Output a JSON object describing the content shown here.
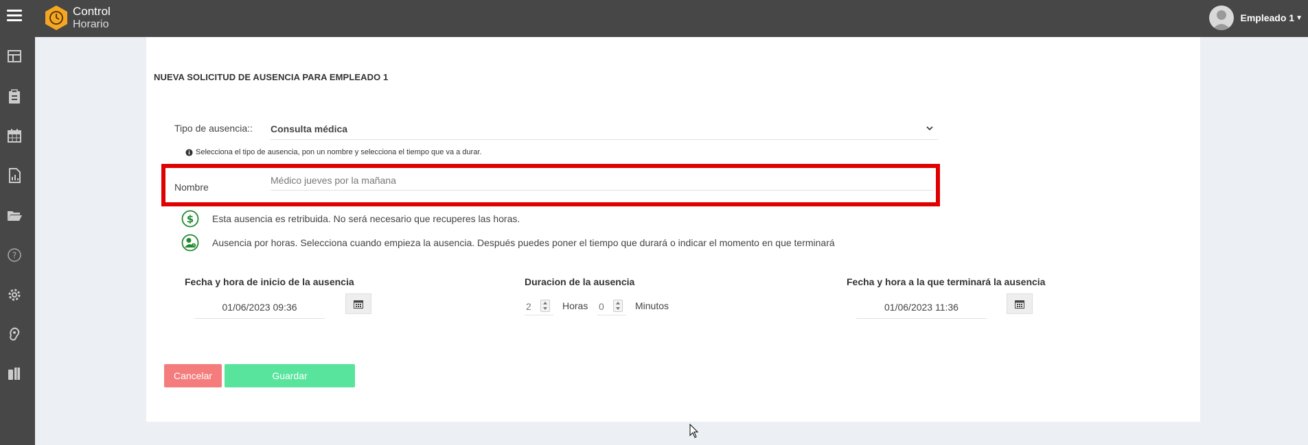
{
  "app": {
    "title_line1": "Control",
    "title_line2": "Horario",
    "user_name": "Empleado 1"
  },
  "colors": {
    "topbar": "#474747",
    "accent_orange": "#f5a623",
    "highlight_red": "#e00000",
    "cancel": "#f47c7c",
    "save": "#58e49c",
    "icon_green": "#1e8a2e"
  },
  "sidebar": {
    "items": [
      {
        "icon": "dashboard-icon"
      },
      {
        "icon": "clipboard-icon"
      },
      {
        "icon": "calendar-icon"
      },
      {
        "icon": "report-icon"
      },
      {
        "icon": "folder-icon"
      },
      {
        "icon": "help-icon"
      },
      {
        "icon": "gear-icon"
      },
      {
        "icon": "ear-icon"
      },
      {
        "icon": "people-icon"
      }
    ]
  },
  "form": {
    "title": "NUEVA SOLICITUD DE AUSENCIA PARA EMPLEADO 1",
    "tipo_label": "Tipo de ausencia::",
    "tipo_value": "Consulta médica",
    "hint": "Selecciona el tipo de ausencia, pon un nombre y selecciona el tiempo que va a durar.",
    "nombre_label": "Nombre",
    "nombre_value": "Médico jueves por la mañana",
    "paid_text": "Esta ausencia es retribuida. No será necesario que recuperes las horas.",
    "hours_text": "Ausencia por horas. Selecciona cuando empieza la ausencia. Después puedes poner el tiempo que durará o indicar el momento en que terminará",
    "start_label": "Fecha y hora de inicio de la ausencia",
    "start_value": "01/06/2023 09:36",
    "duration_label": "Duracion de la ausencia",
    "hours_value": "2",
    "hours_unit": "Horas",
    "minutes_value": "0",
    "minutes_unit": "Minutos",
    "end_label": "Fecha y hora a la que terminará la ausencia",
    "end_value": "01/06/2023 11:36",
    "cancel_label": "Cancelar",
    "save_label": "Guardar"
  }
}
